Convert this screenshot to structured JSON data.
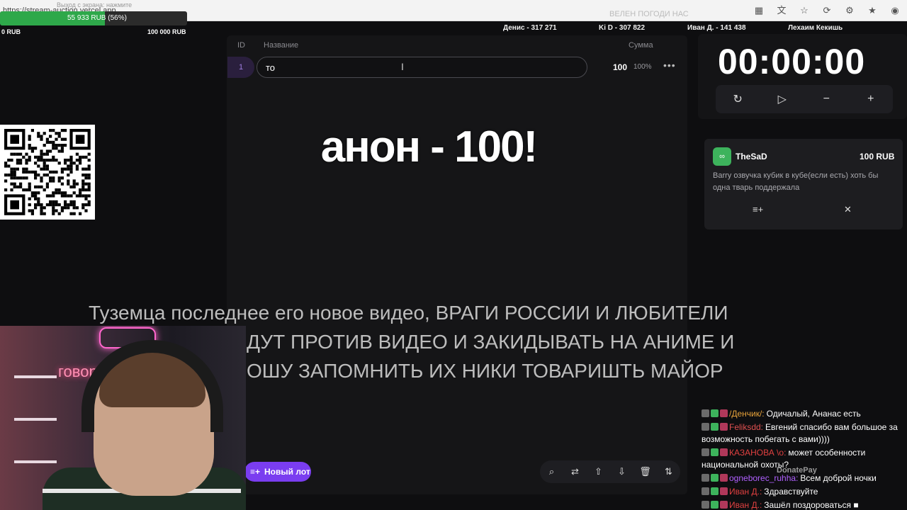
{
  "browser": {
    "url": "https://stream-auction.vercel.app",
    "tab_ghost": "Выход с экрана: нажмите",
    "ghost2": "ВЕЛЕН ПОГОДИ НАС"
  },
  "progress": {
    "label": "55 933 RUB (56%)",
    "fraction": 0.56,
    "min": "0 RUB",
    "max": "100 000 RUB"
  },
  "leaders": [
    "Денис - 317 271",
    "Ki D - 307 822",
    "Иван Д. - 141 438",
    "Лехаим Кекишь"
  ],
  "table": {
    "headers": {
      "id": "ID",
      "name": "Название",
      "sum": "Сумма"
    },
    "row": {
      "id": "1",
      "name_value": "то",
      "sum": "100",
      "pct": "100%"
    }
  },
  "overlay_big": "анон - 100!",
  "caption_lines": [
    "Туземца последнее его новое видео, ВРАГИ РОССИИ И ЛЮБИТЕЛИ",
    "ДУТ ПРОТИВ ВИДЕО И ЗАКИДЫВАТЬ НА АНИМЕ И",
    "ОШУ ЗАПОМНИТЬ ИХ НИКИ ТОВАРИШТЬ МАЙОР"
  ],
  "new_lot_label": "Новый лот",
  "timer": "00:00:00",
  "donation": {
    "name": "TheSaD",
    "amount": "100 RUB",
    "message": "Barry озвучка кубик в кубе(если есть) хоть бы одна тварь поддержала"
  },
  "chat": [
    {
      "user": "/Денчик/:",
      "color": "#e8a33a",
      "text": "Одичалый, Ананас есть"
    },
    {
      "user": "Feliksdd:",
      "color": "#e05050",
      "text": "Евгений спасибо вам большое за возможность побегать с вами))))"
    },
    {
      "user": "КАЗАНОВА \\o:",
      "color": "#e04040",
      "text": "может особенности национальной охоты?"
    },
    {
      "user": "ogneborec_ruhha:",
      "color": "#b060ff",
      "text": "Всем доброй ночки"
    },
    {
      "user": "Иван Д.:",
      "color": "#e04040",
      "text": "Здравствуйте"
    },
    {
      "user": "Иван Д.:",
      "color": "#e04040",
      "text": "Зашёл поздороваться ■"
    }
  ],
  "donatepay_label": "DonatePay",
  "webcam_neon": "говорю",
  "colors": {
    "accent": "#7a3df0",
    "progress": "#2ea84a",
    "donation_avatar": "#3db35c"
  }
}
